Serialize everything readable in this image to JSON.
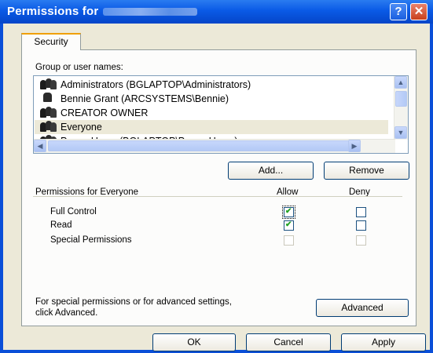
{
  "window": {
    "title": "Permissions for",
    "help_glyph": "?",
    "close_glyph": "✕"
  },
  "tabs": [
    {
      "label": "Security"
    }
  ],
  "group_list": {
    "label": "Group or user names:",
    "items": [
      {
        "label": "Administrators (BGLAPTOP\\Administrators)",
        "icon": "group-icon"
      },
      {
        "label": "Bennie Grant (ARCSYSTEMS\\Bennie)",
        "icon": "user-icon"
      },
      {
        "label": "CREATOR OWNER",
        "icon": "group-icon"
      },
      {
        "label": "Everyone",
        "icon": "group-icon",
        "selected": true
      },
      {
        "label": "Power Users (BGLAPTOP\\Power Users)",
        "icon": "group-icon"
      }
    ]
  },
  "buttons": {
    "add": "Add...",
    "remove": "Remove",
    "advanced": "Advanced",
    "ok": "OK",
    "cancel": "Cancel",
    "apply": "Apply"
  },
  "permissions": {
    "label": "Permissions for Everyone",
    "allow_header": "Allow",
    "deny_header": "Deny",
    "rows": [
      {
        "name": "Full Control",
        "allow": true,
        "deny": false,
        "enabled": true
      },
      {
        "name": "Read",
        "allow": true,
        "deny": false,
        "enabled": true
      },
      {
        "name": "Special Permissions",
        "allow": false,
        "deny": false,
        "enabled": false
      }
    ]
  },
  "footer_text": {
    "line1": "For special permissions or for advanced settings,",
    "line2": "click Advanced."
  },
  "colors": {
    "titlebar": "#0a5ae6",
    "dialog_bg": "#ece9d8",
    "check": "#21a121"
  }
}
